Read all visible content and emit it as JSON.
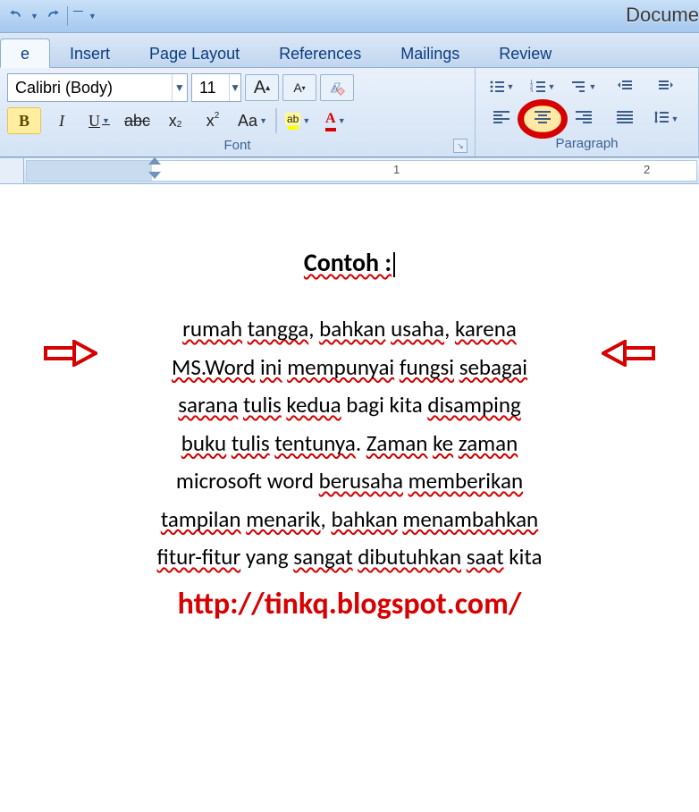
{
  "titlebar": {
    "document_name": "Docume"
  },
  "tabs": {
    "home": "e",
    "insert": "Insert",
    "page_layout": "Page Layout",
    "references": "References",
    "mailings": "Mailings",
    "review": "Review"
  },
  "font_group": {
    "label": "Font",
    "font_name": "Calibri (Body)",
    "font_size": "11",
    "grow_font": "A",
    "shrink_font": "A",
    "bold": "B",
    "italic": "I",
    "underline": "U",
    "strike": "abc",
    "subscript": "x",
    "subscript_sub": "2",
    "superscript": "x",
    "superscript_sup": "2",
    "change_case": "Aa",
    "highlight_ab": "ab",
    "font_color_letter": "A"
  },
  "paragraph_group": {
    "label": "Paragraph"
  },
  "ruler": {
    "mark1": "1",
    "mark2": "2"
  },
  "document": {
    "heading": "Contoh :",
    "lines": [
      [
        "rumah",
        " ",
        "tangga",
        ", ",
        "bahkan",
        " ",
        "usaha",
        ", ",
        "karena"
      ],
      [
        "MS.Word",
        " ",
        "ini",
        " ",
        "mempunyai",
        " ",
        "fungsi",
        " ",
        "sebagai"
      ],
      [
        "sarana",
        " ",
        "tulis",
        " ",
        "kedua",
        " bagi kita ",
        "disamping"
      ],
      [
        "buku",
        " ",
        "tulis",
        " ",
        "tentunya",
        ".  ",
        "Zaman",
        " ",
        "ke",
        " ",
        "zaman"
      ],
      [
        "microsoft word ",
        "berusaha",
        " ",
        "memberikan"
      ],
      [
        "tampilan",
        " ",
        "menarik",
        ", ",
        "bahkan",
        " ",
        "menambahkan"
      ],
      [
        "fitur-fitur",
        " yang ",
        "sangat",
        " ",
        "dibutuhkan",
        " ",
        "saat",
        " kita"
      ]
    ],
    "watermark": "http://tinkq.blogspot.com/"
  }
}
